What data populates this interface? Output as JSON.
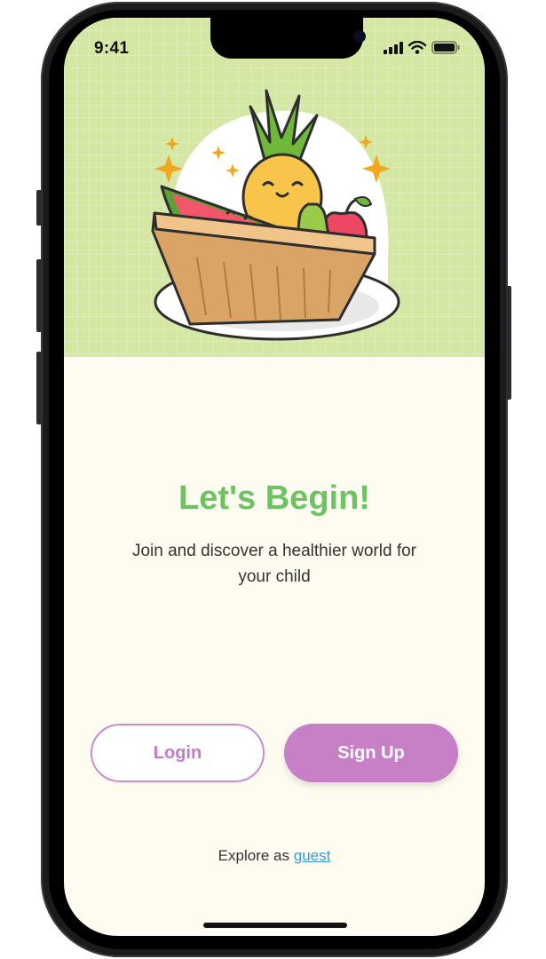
{
  "status_bar": {
    "time": "9:41"
  },
  "onboarding": {
    "title": "Let's Begin!",
    "subtitle": "Join and discover a healthier world for your child",
    "login_label": "Login",
    "signup_label": "Sign Up",
    "guest_prefix": "Explore as",
    "guest_link": "guest"
  },
  "colors": {
    "hero_bg": "#d4e8a3",
    "page_bg": "#fefcf1",
    "title_green": "#6cc460",
    "accent_purple": "#c77fc6",
    "link_blue": "#3b9ad9"
  },
  "icons": [
    "signal-icon",
    "wifi-icon",
    "battery-icon",
    "fruit-basket-illustration"
  ]
}
